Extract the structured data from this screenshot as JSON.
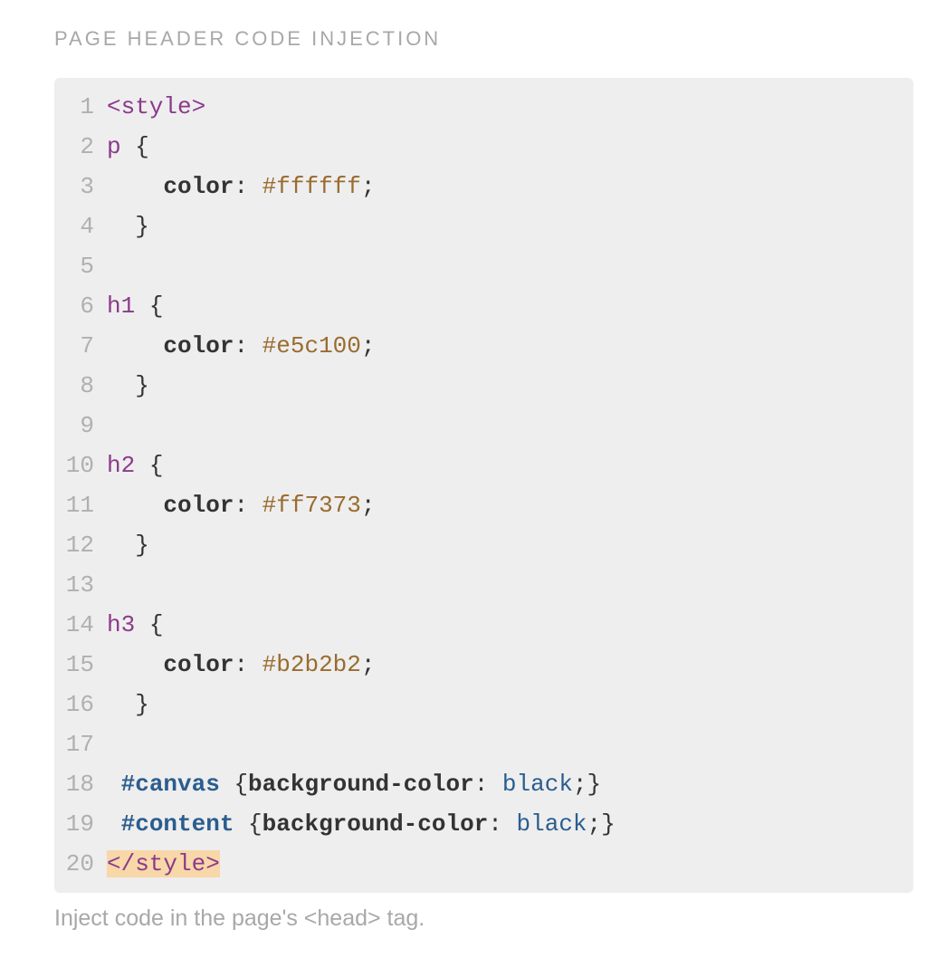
{
  "section_title": "PAGE HEADER CODE INJECTION",
  "help_text": "Inject code in the page's <head> tag.",
  "code": {
    "lines": [
      {
        "num": "1",
        "tokens": [
          {
            "t": "<style>",
            "c": "tok-tag"
          }
        ]
      },
      {
        "num": "2",
        "tokens": [
          {
            "t": "p",
            "c": "tok-sel"
          },
          {
            "t": " ",
            "c": ""
          },
          {
            "t": "{",
            "c": "tok-brace"
          }
        ]
      },
      {
        "num": "3",
        "tokens": [
          {
            "t": "    ",
            "c": ""
          },
          {
            "t": "color",
            "c": "tok-prop"
          },
          {
            "t": ": ",
            "c": "tok-punc"
          },
          {
            "t": "#ffffff",
            "c": "tok-hex"
          },
          {
            "t": ";",
            "c": "tok-punc"
          }
        ]
      },
      {
        "num": "4",
        "tokens": [
          {
            "t": "  ",
            "c": ""
          },
          {
            "t": "}",
            "c": "tok-brace"
          }
        ]
      },
      {
        "num": "5",
        "tokens": [
          {
            "t": "",
            "c": ""
          }
        ]
      },
      {
        "num": "6",
        "tokens": [
          {
            "t": "h1",
            "c": "tok-sel"
          },
          {
            "t": " ",
            "c": ""
          },
          {
            "t": "{",
            "c": "tok-brace"
          }
        ]
      },
      {
        "num": "7",
        "tokens": [
          {
            "t": "    ",
            "c": ""
          },
          {
            "t": "color",
            "c": "tok-prop"
          },
          {
            "t": ": ",
            "c": "tok-punc"
          },
          {
            "t": "#e5c100",
            "c": "tok-hex"
          },
          {
            "t": ";",
            "c": "tok-punc"
          }
        ]
      },
      {
        "num": "8",
        "tokens": [
          {
            "t": "  ",
            "c": ""
          },
          {
            "t": "}",
            "c": "tok-brace"
          }
        ]
      },
      {
        "num": "9",
        "tokens": [
          {
            "t": "",
            "c": ""
          }
        ]
      },
      {
        "num": "10",
        "tokens": [
          {
            "t": "h2",
            "c": "tok-sel"
          },
          {
            "t": " ",
            "c": ""
          },
          {
            "t": "{",
            "c": "tok-brace"
          }
        ]
      },
      {
        "num": "11",
        "tokens": [
          {
            "t": "    ",
            "c": ""
          },
          {
            "t": "color",
            "c": "tok-prop"
          },
          {
            "t": ": ",
            "c": "tok-punc"
          },
          {
            "t": "#ff7373",
            "c": "tok-hex"
          },
          {
            "t": ";",
            "c": "tok-punc"
          }
        ]
      },
      {
        "num": "12",
        "tokens": [
          {
            "t": "  ",
            "c": ""
          },
          {
            "t": "}",
            "c": "tok-brace"
          }
        ]
      },
      {
        "num": "13",
        "tokens": [
          {
            "t": "",
            "c": ""
          }
        ]
      },
      {
        "num": "14",
        "tokens": [
          {
            "t": "h3",
            "c": "tok-sel"
          },
          {
            "t": " ",
            "c": ""
          },
          {
            "t": "{",
            "c": "tok-brace"
          }
        ]
      },
      {
        "num": "15",
        "tokens": [
          {
            "t": "    ",
            "c": ""
          },
          {
            "t": "color",
            "c": "tok-prop"
          },
          {
            "t": ": ",
            "c": "tok-punc"
          },
          {
            "t": "#b2b2b2",
            "c": "tok-hex"
          },
          {
            "t": ";",
            "c": "tok-punc"
          }
        ]
      },
      {
        "num": "16",
        "tokens": [
          {
            "t": "  ",
            "c": ""
          },
          {
            "t": "}",
            "c": "tok-brace"
          }
        ]
      },
      {
        "num": "17",
        "tokens": [
          {
            "t": "",
            "c": ""
          }
        ]
      },
      {
        "num": "18",
        "tokens": [
          {
            "t": " ",
            "c": ""
          },
          {
            "t": "#canvas",
            "c": "tok-idsel"
          },
          {
            "t": " ",
            "c": ""
          },
          {
            "t": "{",
            "c": "tok-brace"
          },
          {
            "t": "background-color",
            "c": "tok-prop"
          },
          {
            "t": ": ",
            "c": "tok-punc"
          },
          {
            "t": "black",
            "c": "tok-kw"
          },
          {
            "t": ";",
            "c": "tok-punc"
          },
          {
            "t": "}",
            "c": "tok-brace"
          }
        ]
      },
      {
        "num": "19",
        "tokens": [
          {
            "t": " ",
            "c": ""
          },
          {
            "t": "#content",
            "c": "tok-idsel"
          },
          {
            "t": " ",
            "c": ""
          },
          {
            "t": "{",
            "c": "tok-brace"
          },
          {
            "t": "background-color",
            "c": "tok-prop"
          },
          {
            "t": ": ",
            "c": "tok-punc"
          },
          {
            "t": "black",
            "c": "tok-kw"
          },
          {
            "t": ";",
            "c": "tok-punc"
          },
          {
            "t": "}",
            "c": "tok-brace"
          }
        ]
      },
      {
        "num": "20",
        "tokens": [
          {
            "t": "</style>",
            "c": "tok-closing-hl"
          }
        ]
      }
    ]
  }
}
